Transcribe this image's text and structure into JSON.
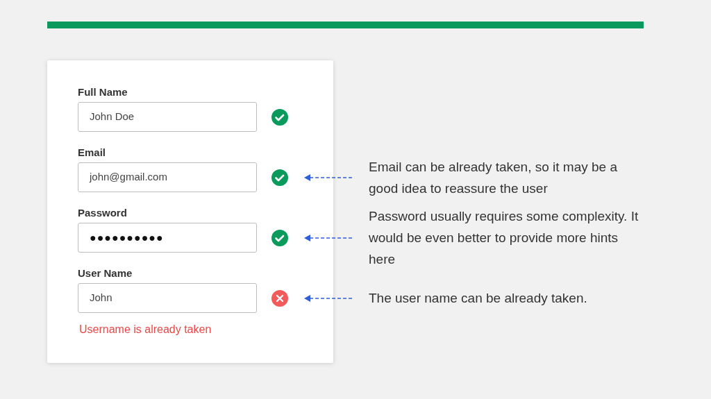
{
  "fields": [
    {
      "label": "Full Name",
      "value": "John Doe",
      "valid": true
    },
    {
      "label": "Email",
      "value": "john@gmail.com",
      "valid": true,
      "note": "Email can be already taken, so it may be a good idea to reassure the user"
    },
    {
      "label": "Password",
      "value": "●●●●●●●●●●",
      "kind": "masked",
      "valid": true,
      "note": "Password usually requires some complexity. It would be even better to provide more hints here"
    },
    {
      "label": "User Name",
      "value": "John",
      "valid": false,
      "error": "Username is already taken",
      "note": "The user name can be already taken."
    }
  ]
}
